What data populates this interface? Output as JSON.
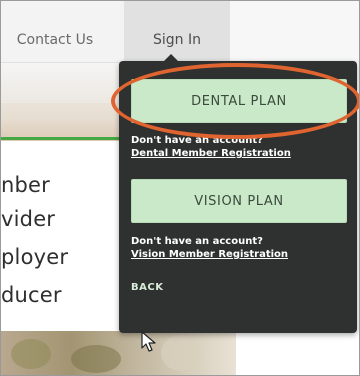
{
  "nav": {
    "contact_label": "Contact Us",
    "signin_label": "Sign In"
  },
  "page": {
    "roles": [
      "nber",
      "vider",
      "ployer",
      "ducer"
    ]
  },
  "dropdown": {
    "dental_label": "DENTAL PLAN",
    "dental_note": "Don't have an account?",
    "dental_link": "Dental Member Registration",
    "vision_label": "VISION PLAN",
    "vision_note": "Don't have an account?",
    "vision_link": "Vision Member Registration",
    "back_label": "BACK"
  },
  "colors": {
    "panel_bg": "#2f3130",
    "button_bg": "#c9e9c9",
    "highlight": "#e0642f",
    "accent_green": "#45a843"
  },
  "icons": {
    "cursor": "mouse-pointer-icon"
  }
}
